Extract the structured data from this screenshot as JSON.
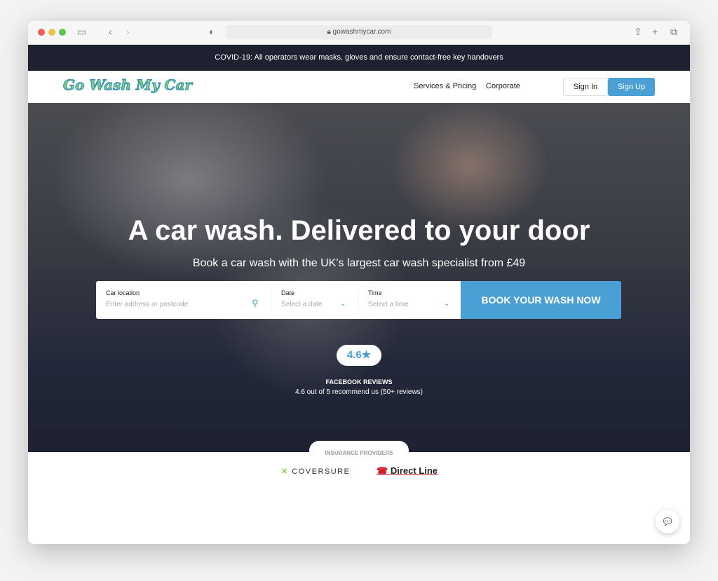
{
  "browser": {
    "url": "gowashmycar.com"
  },
  "banner": {
    "text": "COVID-19: All operators wear masks, gloves and ensure contact-free key handovers"
  },
  "nav": {
    "logo": "Go Wash My Car",
    "links": [
      "Services & Pricing",
      "Corporate"
    ],
    "sign_in": "Sign In",
    "sign_up": "Sign Up"
  },
  "hero": {
    "title": "A car wash. Delivered to your door",
    "subtitle": "Book a car wash with the UK's largest car wash specialist from £49",
    "form": {
      "location_label": "Car location",
      "location_placeholder": "Enter address or postcode",
      "date_label": "Date",
      "date_placeholder": "Select a date",
      "time_label": "Time",
      "time_placeholder": "Select a time",
      "book_button": "BOOK YOUR WASH NOW"
    },
    "rating": {
      "value": "4.6★",
      "source": "FACEBOOK REVIEWS",
      "summary": "4.6 out of 5 recommend us (50+ reviews)"
    }
  },
  "insurance": {
    "label": "INSURANCE PROVIDERS",
    "providers": [
      "COVERSURE",
      "Direct Line"
    ]
  },
  "colors": {
    "accent": "#4a9fd4",
    "dark": "#1d2130"
  }
}
